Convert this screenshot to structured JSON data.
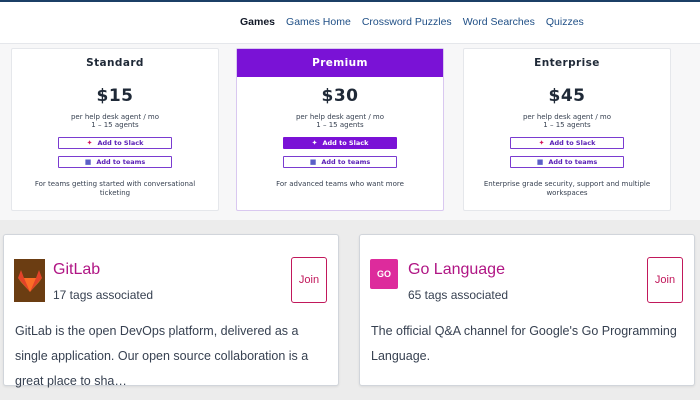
{
  "nav": {
    "items": [
      "Games",
      "Games Home",
      "Crossword Puzzles",
      "Word Searches",
      "Quizzes"
    ],
    "active_index": 0
  },
  "pricing": {
    "add_to_slack_label": "Add to Slack",
    "add_to_teams_label": "Add to teams",
    "plans": [
      {
        "name": "Standard",
        "price": "$15",
        "unit": "per help desk agent / mo",
        "agents": "1 – 15 agents",
        "description": "For teams getting started with conversational ticketing"
      },
      {
        "name": "Premium",
        "price": "$30",
        "unit": "per help desk agent / mo",
        "agents": "1 – 15 agents",
        "description": "For advanced teams who want more"
      },
      {
        "name": "Enterprise",
        "price": "$45",
        "unit": "per help desk agent / mo",
        "agents": "1 – 15 agents",
        "description": "Enterprise grade security, support and multiple workspaces"
      }
    ]
  },
  "channels": [
    {
      "name": "GitLab",
      "tags": "17 tags associated",
      "description": "GitLab is the open DevOps platform, delivered as a single application. Our open source collaboration is a great place to sha…",
      "join_label": "Join",
      "logo_icon": "gitlab-logo-icon"
    },
    {
      "name": "Go Language",
      "tags": "65 tags associated",
      "description": "The official Q&A channel for Google's Go Programming Language.",
      "join_label": "Join",
      "logo_text": "GO",
      "logo_icon": "go-logo-icon"
    }
  ],
  "colors": {
    "accent_purple": "#7a12d6",
    "channel_name": "#b01584",
    "join_border": "#c1185b",
    "nav_link": "#1f4f86"
  }
}
